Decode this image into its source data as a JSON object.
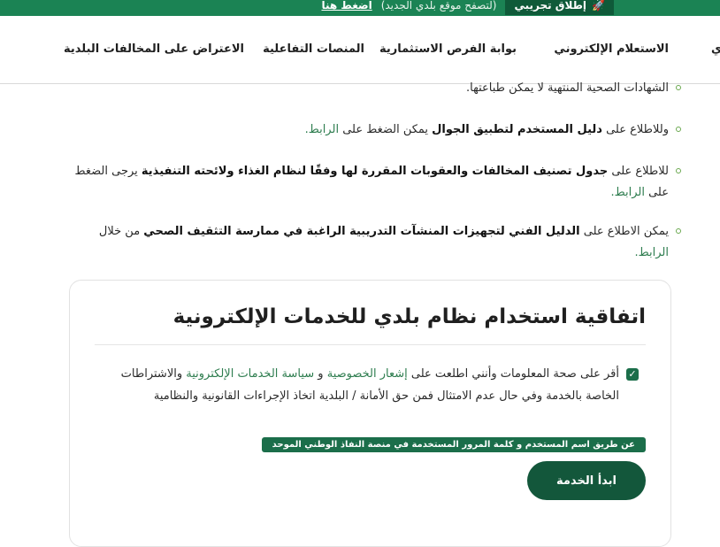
{
  "topbar": {
    "beta_label": "إطلاق تجريبي",
    "notice": "(لتصفح موقع بلدي الجديد)",
    "link": "اضغط هنا",
    "rocket_icon": "rocket-icon"
  },
  "nav": {
    "items": [
      "الاستعلام الإلكتروني",
      "بوابة الفرص الاستثمارية",
      "المنصات التفاعلية",
      "الاعتراض على المخالفات البلدية"
    ],
    "cut_item": "ي"
  },
  "content": {
    "b1_text": "الشهادات الصحية المنتهية لا يمكن طباعتها.",
    "b2_pre": "وللاطلاع على ",
    "b2_bold": "دليل المستخدم لتطبيق الجوال",
    "b2_post": " يمكن الضغط على ",
    "b2_link": "الرابط.",
    "b3_pre": "للاطلاع على ",
    "b3_bold": "جدول تصنيف المخالفات والعقوبات المقررة لها وفقًا لنظام الغذاء ولائحته التنفيذية",
    "b3_post": " يرجى الضغط على ",
    "b3_link": "الرابط.",
    "b4_pre": "يمكن الاطلاع على ",
    "b4_bold": "الدليل الفني لتجهيزات المنشآت التدريبية الراغبة في ممارسة التثقيف الصحي",
    "b4_post": " من خلال ",
    "b4_link": "الرابط."
  },
  "agreement": {
    "title": "اتفاقية استخدام نظام بلدي للخدمات الإلكترونية",
    "text_pre": "أقر على صحة المعلومات وأنني اطلعت على ",
    "privacy_link": "إشعار الخصوصية",
    "and": " و ",
    "policy_link": "سياسة الخدمات الإلكترونية",
    "text_post": " والاشتراطات الخاصة بالخدمة وفي حال عدم الامتثال فمن حق الأمانة / البلدية اتخاذ الإجراءات القانونية والنظامية",
    "checked": "✓",
    "nafath_label": "عن طريق اسم المستخدم و كلمة المرور المستخدمة في منصة النفاذ الوطني الموحد",
    "start_button": "ابدأ الخدمة"
  },
  "colors": {
    "brand_green": "#1b8354",
    "dark_green": "#13573b",
    "link_green": "#2e7d4f"
  }
}
